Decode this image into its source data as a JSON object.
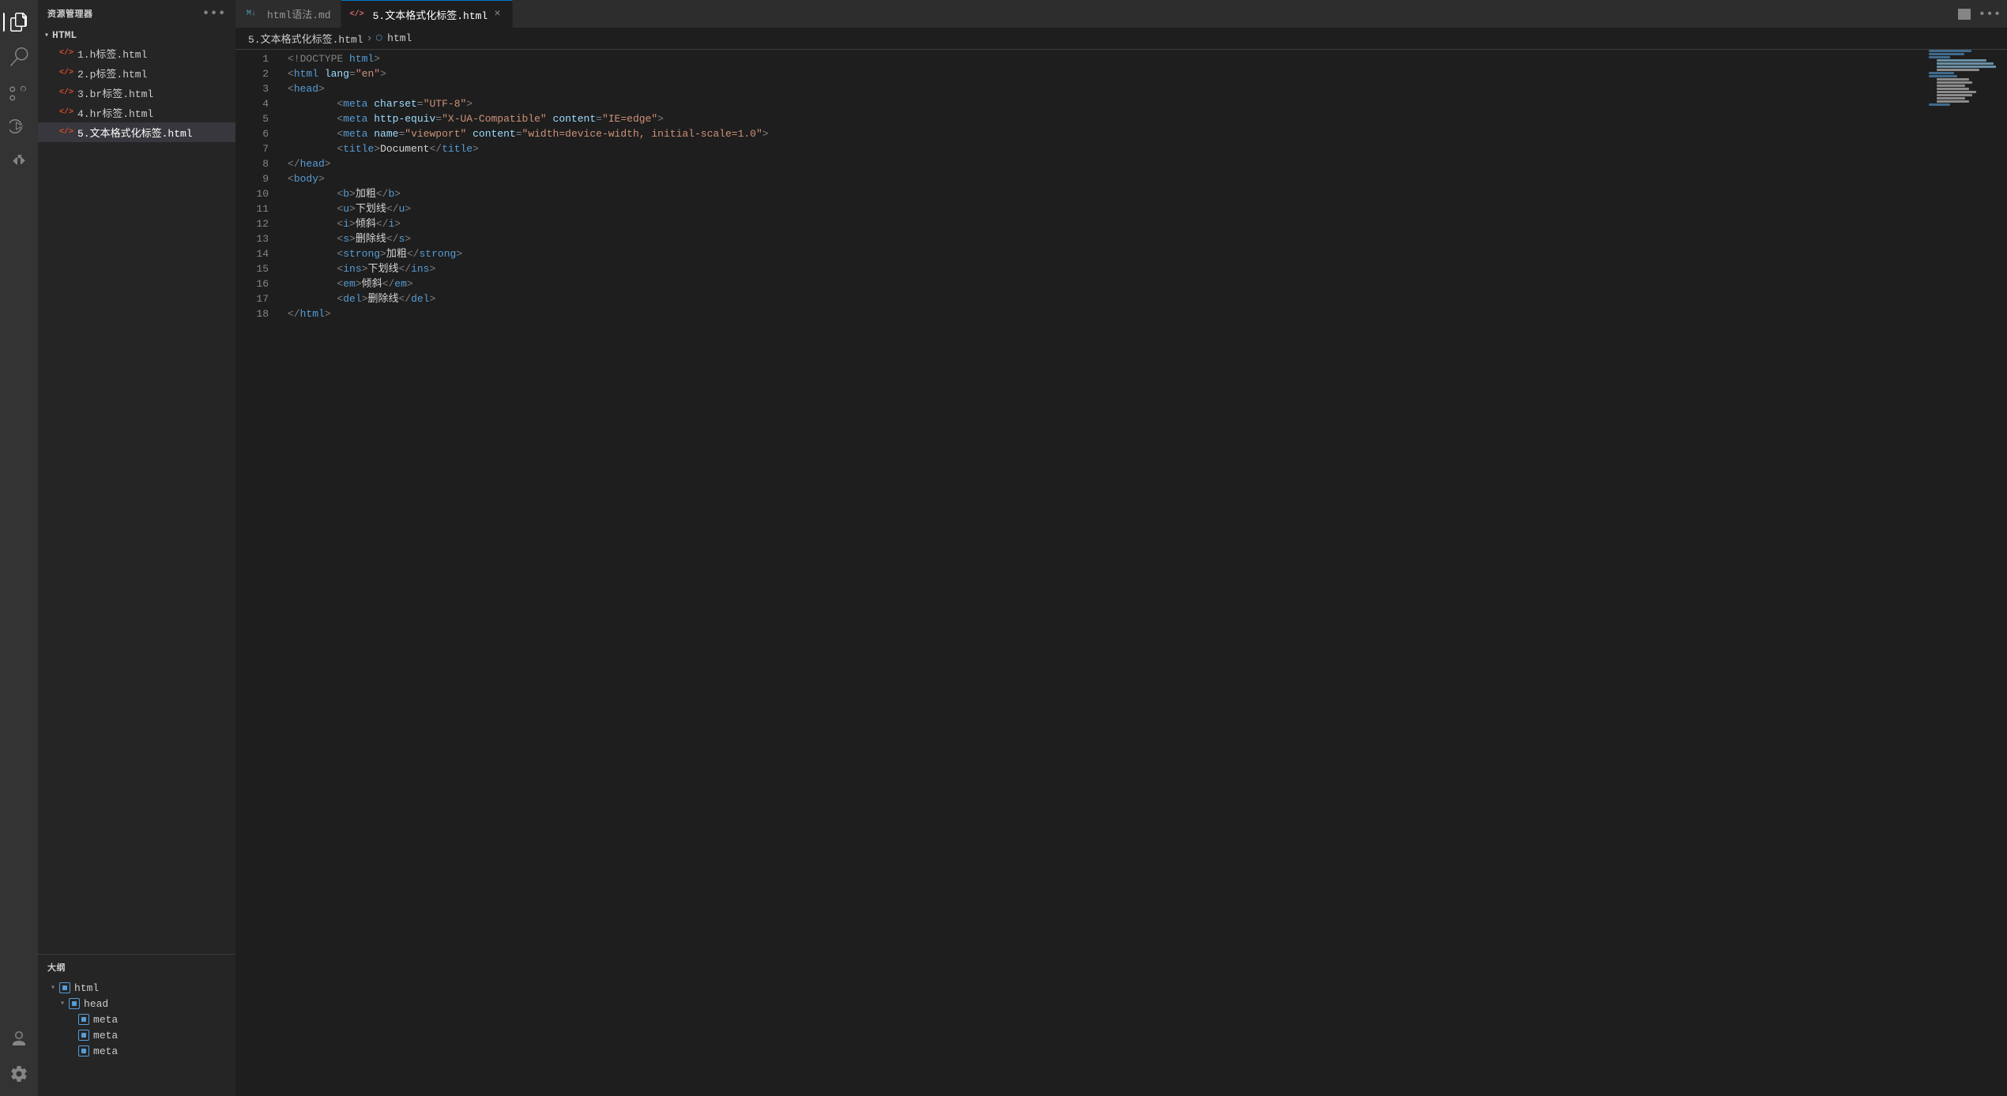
{
  "activityBar": {
    "icons": [
      {
        "name": "explorer-icon",
        "symbol": "⎘",
        "active": true
      },
      {
        "name": "search-icon",
        "symbol": "🔍",
        "active": false
      },
      {
        "name": "source-control-icon",
        "symbol": "⎇",
        "active": false
      },
      {
        "name": "run-icon",
        "symbol": "▶",
        "active": false
      },
      {
        "name": "extensions-icon",
        "symbol": "⊞",
        "active": false
      }
    ],
    "bottomIcons": [
      {
        "name": "account-icon",
        "symbol": "👤"
      },
      {
        "name": "settings-icon",
        "symbol": "⚙"
      }
    ]
  },
  "sidebar": {
    "header": "资源管理器",
    "moreLabel": "•••",
    "folder": {
      "name": "HTML",
      "expanded": true,
      "files": [
        {
          "name": "1.h标签.html",
          "active": false
        },
        {
          "name": "2.p标签.html",
          "active": false
        },
        {
          "name": "3.br标签.html",
          "active": false
        },
        {
          "name": "4.hr标签.html",
          "active": false
        },
        {
          "name": "5.文本格式化标签.html",
          "active": true
        }
      ]
    }
  },
  "outline": {
    "header": "大纲",
    "items": [
      {
        "label": "html",
        "level": 1,
        "expanded": true,
        "hasChevron": true
      },
      {
        "label": "head",
        "level": 2,
        "expanded": true,
        "hasChevron": true
      },
      {
        "label": "meta",
        "level": 3,
        "expanded": false,
        "hasChevron": false
      },
      {
        "label": "meta",
        "level": 3,
        "expanded": false,
        "hasChevron": false
      },
      {
        "label": "meta",
        "level": 3,
        "expanded": false,
        "hasChevron": false
      }
    ]
  },
  "tabs": [
    {
      "label": "html语法.md",
      "active": false,
      "icon": "md",
      "closeable": false
    },
    {
      "label": "5.文本格式化标签.html",
      "active": true,
      "icon": "html",
      "closeable": true
    }
  ],
  "breadcrumb": [
    {
      "label": "5.文本格式化标签.html"
    },
    {
      "label": "html",
      "icon": true
    }
  ],
  "editor": {
    "lines": [
      {
        "num": 1,
        "tokens": [
          {
            "t": "gray",
            "v": "<!DOCTYPE "
          },
          {
            "t": "blue",
            "v": "html"
          },
          {
            "t": "gray",
            "v": ">"
          }
        ]
      },
      {
        "num": 2,
        "tokens": [
          {
            "t": "gray",
            "v": "<"
          },
          {
            "t": "blue",
            "v": "html"
          },
          {
            "t": "lt-blue",
            "v": " lang"
          },
          {
            "t": "gray",
            "v": "="
          },
          {
            "t": "orange",
            "v": "\"en\""
          },
          {
            "t": "gray",
            "v": ">"
          }
        ]
      },
      {
        "num": 3,
        "tokens": [
          {
            "t": "gray",
            "v": "<"
          },
          {
            "t": "blue",
            "v": "head"
          },
          {
            "t": "gray",
            "v": ">"
          }
        ]
      },
      {
        "num": 4,
        "tokens": [
          {
            "t": "white",
            "v": "    "
          },
          {
            "t": "gray",
            "v": "<"
          },
          {
            "t": "blue",
            "v": "meta"
          },
          {
            "t": "lt-blue",
            "v": " charset"
          },
          {
            "t": "gray",
            "v": "="
          },
          {
            "t": "orange",
            "v": "\"UTF-8\""
          },
          {
            "t": "gray",
            "v": ">"
          }
        ]
      },
      {
        "num": 5,
        "tokens": [
          {
            "t": "white",
            "v": "    "
          },
          {
            "t": "gray",
            "v": "<"
          },
          {
            "t": "blue",
            "v": "meta"
          },
          {
            "t": "lt-blue",
            "v": " http-equiv"
          },
          {
            "t": "gray",
            "v": "="
          },
          {
            "t": "orange",
            "v": "\"X-UA-Compatible\""
          },
          {
            "t": "lt-blue",
            "v": " content"
          },
          {
            "t": "gray",
            "v": "="
          },
          {
            "t": "orange",
            "v": "\"IE=edge\""
          },
          {
            "t": "gray",
            "v": ">"
          }
        ]
      },
      {
        "num": 6,
        "tokens": [
          {
            "t": "white",
            "v": "    "
          },
          {
            "t": "gray",
            "v": "<"
          },
          {
            "t": "blue",
            "v": "meta"
          },
          {
            "t": "lt-blue",
            "v": " name"
          },
          {
            "t": "gray",
            "v": "="
          },
          {
            "t": "orange",
            "v": "\"viewport\""
          },
          {
            "t": "lt-blue",
            "v": " content"
          },
          {
            "t": "gray",
            "v": "="
          },
          {
            "t": "orange",
            "v": "\"width=device-width, initial-scale=1.0\""
          },
          {
            "t": "gray",
            "v": ">"
          }
        ]
      },
      {
        "num": 7,
        "tokens": [
          {
            "t": "white",
            "v": "    "
          },
          {
            "t": "gray",
            "v": "<"
          },
          {
            "t": "blue",
            "v": "title"
          },
          {
            "t": "gray",
            "v": ">"
          },
          {
            "t": "white",
            "v": "Document"
          },
          {
            "t": "gray",
            "v": "</"
          },
          {
            "t": "blue",
            "v": "title"
          },
          {
            "t": "gray",
            "v": ">"
          }
        ]
      },
      {
        "num": 8,
        "tokens": [
          {
            "t": "gray",
            "v": "</"
          },
          {
            "t": "blue",
            "v": "head"
          },
          {
            "t": "gray",
            "v": ">"
          }
        ]
      },
      {
        "num": 9,
        "tokens": [
          {
            "t": "gray",
            "v": "<"
          },
          {
            "t": "blue",
            "v": "body"
          },
          {
            "t": "gray",
            "v": ">"
          }
        ]
      },
      {
        "num": 10,
        "tokens": [
          {
            "t": "white",
            "v": "    "
          },
          {
            "t": "gray",
            "v": "<"
          },
          {
            "t": "blue",
            "v": "b"
          },
          {
            "t": "gray",
            "v": ">"
          },
          {
            "t": "white",
            "v": "加粗"
          },
          {
            "t": "gray",
            "v": "</"
          },
          {
            "t": "blue",
            "v": "b"
          },
          {
            "t": "gray",
            "v": ">"
          }
        ]
      },
      {
        "num": 11,
        "tokens": [
          {
            "t": "white",
            "v": "    "
          },
          {
            "t": "gray",
            "v": "<"
          },
          {
            "t": "blue",
            "v": "u"
          },
          {
            "t": "gray",
            "v": ">"
          },
          {
            "t": "white",
            "v": "下划线"
          },
          {
            "t": "gray",
            "v": "</"
          },
          {
            "t": "blue",
            "v": "u"
          },
          {
            "t": "gray",
            "v": ">"
          }
        ]
      },
      {
        "num": 12,
        "tokens": [
          {
            "t": "white",
            "v": "    "
          },
          {
            "t": "gray",
            "v": "<"
          },
          {
            "t": "blue",
            "v": "i"
          },
          {
            "t": "gray",
            "v": ">"
          },
          {
            "t": "white",
            "v": "倾斜"
          },
          {
            "t": "gray",
            "v": "</"
          },
          {
            "t": "blue",
            "v": "i"
          },
          {
            "t": "gray",
            "v": ">"
          }
        ]
      },
      {
        "num": 13,
        "tokens": [
          {
            "t": "white",
            "v": "    "
          },
          {
            "t": "gray",
            "v": "<"
          },
          {
            "t": "blue",
            "v": "s"
          },
          {
            "t": "gray",
            "v": ">"
          },
          {
            "t": "white",
            "v": "删除线"
          },
          {
            "t": "gray",
            "v": "</"
          },
          {
            "t": "blue",
            "v": "s"
          },
          {
            "t": "gray",
            "v": ">"
          }
        ]
      },
      {
        "num": 14,
        "tokens": [
          {
            "t": "white",
            "v": "    "
          },
          {
            "t": "gray",
            "v": "<"
          },
          {
            "t": "blue",
            "v": "strong"
          },
          {
            "t": "gray",
            "v": ">"
          },
          {
            "t": "white",
            "v": "加粗"
          },
          {
            "t": "gray",
            "v": "</"
          },
          {
            "t": "blue",
            "v": "strong"
          },
          {
            "t": "gray",
            "v": ">"
          }
        ]
      },
      {
        "num": 15,
        "tokens": [
          {
            "t": "white",
            "v": "    "
          },
          {
            "t": "gray",
            "v": "<"
          },
          {
            "t": "blue",
            "v": "ins"
          },
          {
            "t": "gray",
            "v": ">"
          },
          {
            "t": "white",
            "v": "下划线"
          },
          {
            "t": "gray",
            "v": "</"
          },
          {
            "t": "blue",
            "v": "ins"
          },
          {
            "t": "gray",
            "v": ">"
          }
        ]
      },
      {
        "num": 16,
        "tokens": [
          {
            "t": "white",
            "v": "    "
          },
          {
            "t": "gray",
            "v": "<"
          },
          {
            "t": "blue",
            "v": "em"
          },
          {
            "t": "gray",
            "v": ">"
          },
          {
            "t": "white",
            "v": "倾斜"
          },
          {
            "t": "gray",
            "v": "</"
          },
          {
            "t": "blue",
            "v": "em"
          },
          {
            "t": "gray",
            "v": ">"
          }
        ]
      },
      {
        "num": 17,
        "tokens": [
          {
            "t": "white",
            "v": "    "
          },
          {
            "t": "gray",
            "v": "<"
          },
          {
            "t": "blue",
            "v": "del"
          },
          {
            "t": "gray",
            "v": ">"
          },
          {
            "t": "white",
            "v": "删除线"
          },
          {
            "t": "gray",
            "v": "</"
          },
          {
            "t": "blue",
            "v": "del"
          },
          {
            "t": "gray",
            "v": ">"
          }
        ]
      },
      {
        "num": 18,
        "tokens": [
          {
            "t": "gray",
            "v": "</"
          },
          {
            "t": "blue",
            "v": "html"
          },
          {
            "t": "gray",
            "v": ">"
          }
        ]
      }
    ]
  }
}
